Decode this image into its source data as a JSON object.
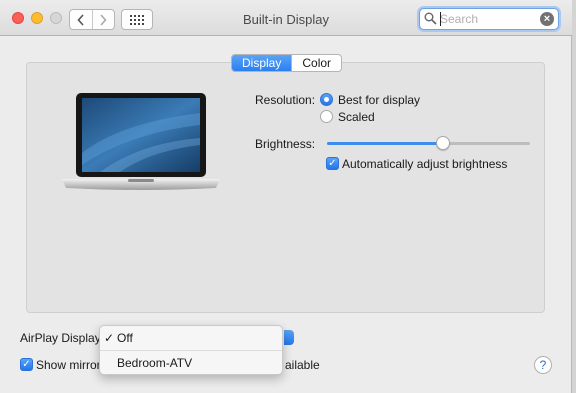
{
  "window": {
    "title": "Built-in Display"
  },
  "search": {
    "placeholder": "Search"
  },
  "tabs": [
    {
      "label": "Display",
      "selected": true
    },
    {
      "label": "Color",
      "selected": false
    }
  ],
  "resolution": {
    "label": "Resolution:",
    "options": [
      {
        "label": "Best for display",
        "selected": true
      },
      {
        "label": "Scaled",
        "selected": false
      }
    ]
  },
  "brightness": {
    "label": "Brightness:",
    "level": 0.57,
    "auto_adjust": {
      "label": "Automatically adjust brightness",
      "checked": true
    }
  },
  "airplay": {
    "label": "AirPlay Display",
    "menu": [
      {
        "label": "Off",
        "checked": true
      },
      {
        "label": "Bedroom-ATV",
        "checked": false
      }
    ],
    "checkmark": "✓"
  },
  "mirror": {
    "label_left": "Show mirror",
    "label_right": "ailable",
    "checked": true
  },
  "help": {
    "label": "?"
  },
  "colors": {
    "accent": "#2b7ff0",
    "close": "#fc5f57",
    "minimize": "#fdbc2e"
  }
}
